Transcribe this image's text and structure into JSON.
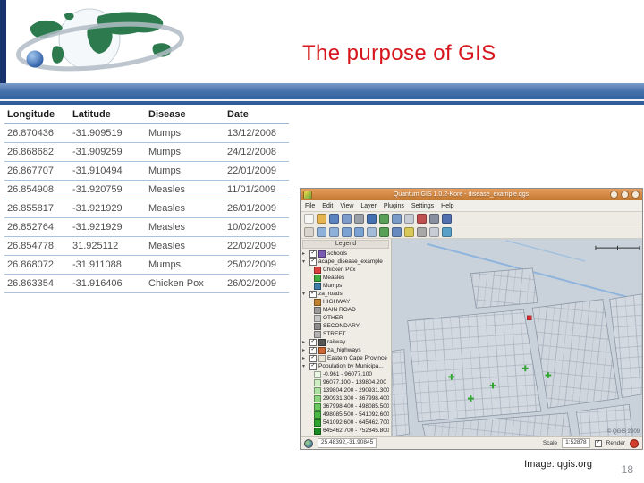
{
  "slide": {
    "title": "The purpose of GIS",
    "caption": "Image: qgis.org",
    "page_number": "18"
  },
  "table": {
    "headers": [
      "Longitude",
      "Latitude",
      "Disease",
      "Date"
    ],
    "rows": [
      [
        "26.870436",
        "-31.909519",
        "Mumps",
        "13/12/2008"
      ],
      [
        "26.868682",
        "-31.909259",
        "Mumps",
        "24/12/2008"
      ],
      [
        "26.867707",
        "-31.910494",
        "Mumps",
        "22/01/2009"
      ],
      [
        "26.854908",
        "-31.920759",
        "Measles",
        "11/01/2009"
      ],
      [
        "26.855817",
        "-31.921929",
        "Measles",
        "26/01/2009"
      ],
      [
        "26.852764",
        "-31.921929",
        "Measles",
        "10/02/2009"
      ],
      [
        "26.854778",
        "31.925112",
        "Measles",
        "22/02/2009"
      ],
      [
        "26.868072",
        "-31.911088",
        "Mumps",
        "25/02/2009"
      ],
      [
        "26.863354",
        "-31.916406",
        "Chicken Pox",
        "26/02/2009"
      ]
    ]
  },
  "qgis": {
    "window_title": "Quantum GIS 1.0.2-Kore - disease_example.qgs",
    "menus": [
      "File",
      "Edit",
      "View",
      "Layer",
      "Plugins",
      "Settings",
      "Help"
    ],
    "toolbars": [
      {
        "icons": [
          {
            "name": "new-project-icon",
            "color": "#f6f6f4"
          },
          {
            "name": "open-project-icon",
            "color": "#e5b44e"
          },
          {
            "name": "save-project-icon",
            "color": "#5b83c0"
          },
          {
            "name": "save-as-icon",
            "color": "#7d9ccb"
          },
          {
            "name": "print-icon",
            "color": "#9aa0a8"
          },
          {
            "name": "add-vector-layer-icon",
            "color": "#4472b0"
          },
          {
            "name": "add-raster-layer-icon",
            "color": "#58a058"
          },
          {
            "name": "add-wms-layer-icon",
            "color": "#7a9ac8"
          },
          {
            "name": "new-vector-layer-icon",
            "color": "#c8ccd4"
          },
          {
            "name": "remove-layer-icon",
            "color": "#c05050"
          },
          {
            "name": "project-properties-icon",
            "color": "#8890a0"
          },
          {
            "name": "help-icon",
            "color": "#5070b0"
          }
        ]
      },
      {
        "icons": [
          {
            "name": "pan-map-icon",
            "color": "#d9d5cc"
          },
          {
            "name": "zoom-in-icon",
            "color": "#8fb0d8"
          },
          {
            "name": "zoom-out-icon",
            "color": "#8fb0d8"
          },
          {
            "name": "zoom-full-icon",
            "color": "#7aa2d2"
          },
          {
            "name": "zoom-to-layer-icon",
            "color": "#7aa2d2"
          },
          {
            "name": "zoom-last-icon",
            "color": "#a3bcd9"
          },
          {
            "name": "refresh-icon",
            "color": "#58a058"
          },
          {
            "name": "identify-icon",
            "color": "#6888c0"
          },
          {
            "name": "select-features-icon",
            "color": "#d8c858"
          },
          {
            "name": "measure-icon",
            "color": "#a8a8a8"
          },
          {
            "name": "attribute-table-icon",
            "color": "#c8ccd4"
          },
          {
            "name": "bookmark-icon",
            "color": "#58a0c8"
          }
        ]
      }
    ],
    "legend": {
      "title": "Legend",
      "items": [
        {
          "label": "schools",
          "symbol_color": "#7a5ab5"
        },
        {
          "label": "acape_disease_example",
          "children": [
            {
              "label": "Chicken Pox",
              "color": "#d94040"
            },
            {
              "label": "Measles",
              "color": "#3faa3f"
            },
            {
              "label": "Mumps",
              "color": "#3f7faa"
            }
          ]
        },
        {
          "label": "za_roads",
          "children": [
            {
              "label": "HIGHWAY",
              "color": "#c08030"
            },
            {
              "label": "MAIN ROAD",
              "color": "#9a9a9a"
            },
            {
              "label": "OTHER",
              "color": "#c6c6c6"
            },
            {
              "label": "SECONDARY",
              "color": "#8d8d8d"
            },
            {
              "label": "STREET",
              "color": "#b3b3b3"
            }
          ]
        },
        {
          "label": "railway",
          "symbol_color": "#555555"
        },
        {
          "label": "za_highways",
          "symbol_color": "#cc6633"
        },
        {
          "label": "Eastern Cape Province",
          "symbol_color": "#e8e4d8"
        },
        {
          "label": "Population by Municipa...",
          "children": [
            {
              "label": "-0.961 - 96077.100",
              "color": "#e9f7e4"
            },
            {
              "label": "96077.100 - 139804.200",
              "color": "#cdeec2"
            },
            {
              "label": "139804.200 - 290931.300",
              "color": "#aee2a0"
            },
            {
              "label": "290931.300 - 367998.400",
              "color": "#8dd57e"
            },
            {
              "label": "367998.400 - 498085.500",
              "color": "#6cc75e"
            },
            {
              "label": "498085.500 - 541092.600",
              "color": "#4cb743"
            },
            {
              "label": "541092.600 - 645462.700",
              "color": "#2fa32e"
            },
            {
              "label": "645462.700 - 752845.800",
              "color": "#1b8a22"
            }
          ]
        }
      ]
    },
    "map": {
      "copyright": "© QGIS 2009"
    },
    "statusbar": {
      "coordinates": "25.48392,-31.90845",
      "scale_label": "Scale",
      "scale_value": "1:52878",
      "render_label": "Render"
    }
  }
}
